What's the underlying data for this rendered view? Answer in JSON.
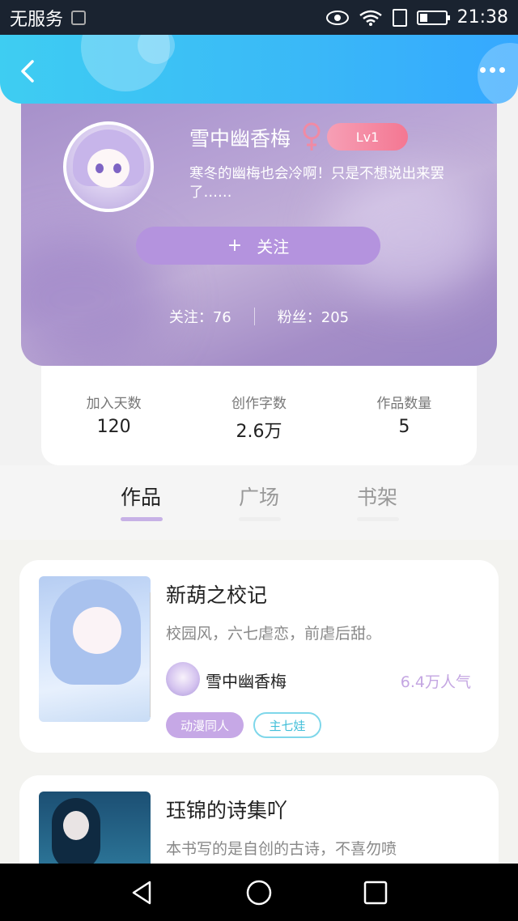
{
  "status_bar": {
    "carrier": "无服务",
    "time": "21:38"
  },
  "header": {
    "back_icon": "chevron-left-icon",
    "more_icon": "more-dots-icon",
    "gradient_colors": [
      "#3ecdf2",
      "#35a8ff"
    ]
  },
  "profile": {
    "username": "雪中幽香梅",
    "gender_icon": "female-icon",
    "level": "Lv1",
    "bio": "寒冬的幽梅也会冷啊！只是不想说出来罢了……",
    "follow_plus": "+",
    "follow_label": "关注",
    "following_text": "关注：76",
    "followers_text": "粉丝：205",
    "card_color": "#a58fc9"
  },
  "stats": [
    {
      "label": "加入天数",
      "value": "120"
    },
    {
      "label": "创作字数",
      "value": "2.6万"
    },
    {
      "label": "作品数量",
      "value": "5"
    }
  ],
  "tabs": [
    {
      "label": "作品",
      "active": true
    },
    {
      "label": "广场",
      "active": false
    },
    {
      "label": "书架",
      "active": false
    }
  ],
  "books": [
    {
      "title": "新葫之校记",
      "description": "校园风，六七虐恋，前虐后甜。",
      "author": "雪中幽香梅",
      "popularity": "6.4万人气",
      "tags": [
        "动漫同人",
        "主七娃"
      ]
    },
    {
      "title": "珏锦的诗集吖",
      "description": "本书写的是自创的古诗，不喜勿喷"
    }
  ],
  "nav": {
    "back_icon": "triangle-back-icon",
    "home_icon": "circle-home-icon",
    "recents_icon": "square-recents-icon"
  }
}
